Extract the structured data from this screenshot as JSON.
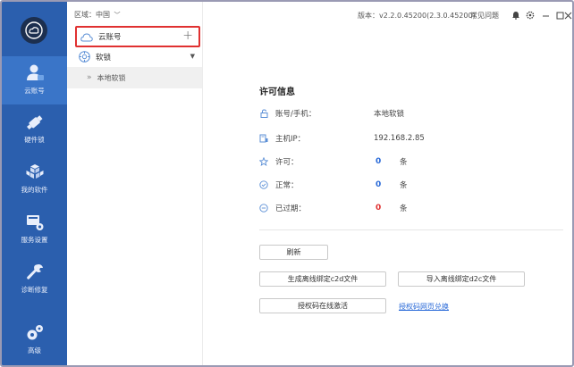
{
  "colors": {
    "rail": "#2b5fae",
    "rail_active": "#3a75c8",
    "highlight_border": "#e03131",
    "accent_blue": "#2a6ad8",
    "expired_red": "#e03131"
  },
  "rail": {
    "items": [
      {
        "label": "云账号",
        "icon": "user-icon",
        "active": true
      },
      {
        "label": "硬件锁",
        "icon": "usb-key-icon",
        "active": false
      },
      {
        "label": "我的软件",
        "icon": "cubes-icon",
        "active": false
      },
      {
        "label": "服务设置",
        "icon": "server-settings-icon",
        "active": false
      },
      {
        "label": "诊断修复",
        "icon": "wrench-icon",
        "active": false
      },
      {
        "label": "高级",
        "icon": "gears-icon",
        "active": false
      }
    ]
  },
  "sidebar": {
    "region": "区域：中国",
    "cloud_account": "云账号",
    "soft_lock": "软锁",
    "local_soft_lock": "本地软锁"
  },
  "titlebar": {
    "version": "版本：v2.2.0.45200(2.3.0.45200)",
    "faq": "常见问题"
  },
  "license": {
    "title": "许可信息",
    "rows": [
      {
        "key": "账号/手机：",
        "value": "本地软锁",
        "icon": "lock-icon"
      },
      {
        "key": "主机IP：",
        "value": "192.168.2.85",
        "icon": "host-icon"
      },
      {
        "key": "许可：",
        "count": "0",
        "unit": "条",
        "icon": "star-icon"
      },
      {
        "key": "正常：",
        "count": "0",
        "unit": "条",
        "icon": "check-circle-icon"
      },
      {
        "key": "已过期：",
        "count": "0",
        "unit": "条",
        "icon": "minus-circle-icon"
      }
    ]
  },
  "actions": {
    "refresh": "刷新",
    "gen_c2d": "生成离线绑定c2d文件",
    "import_d2c": "导入离线绑定d2c文件",
    "online_activate": "授权码在线激活",
    "web_redeem": "授权码网页兑换"
  }
}
